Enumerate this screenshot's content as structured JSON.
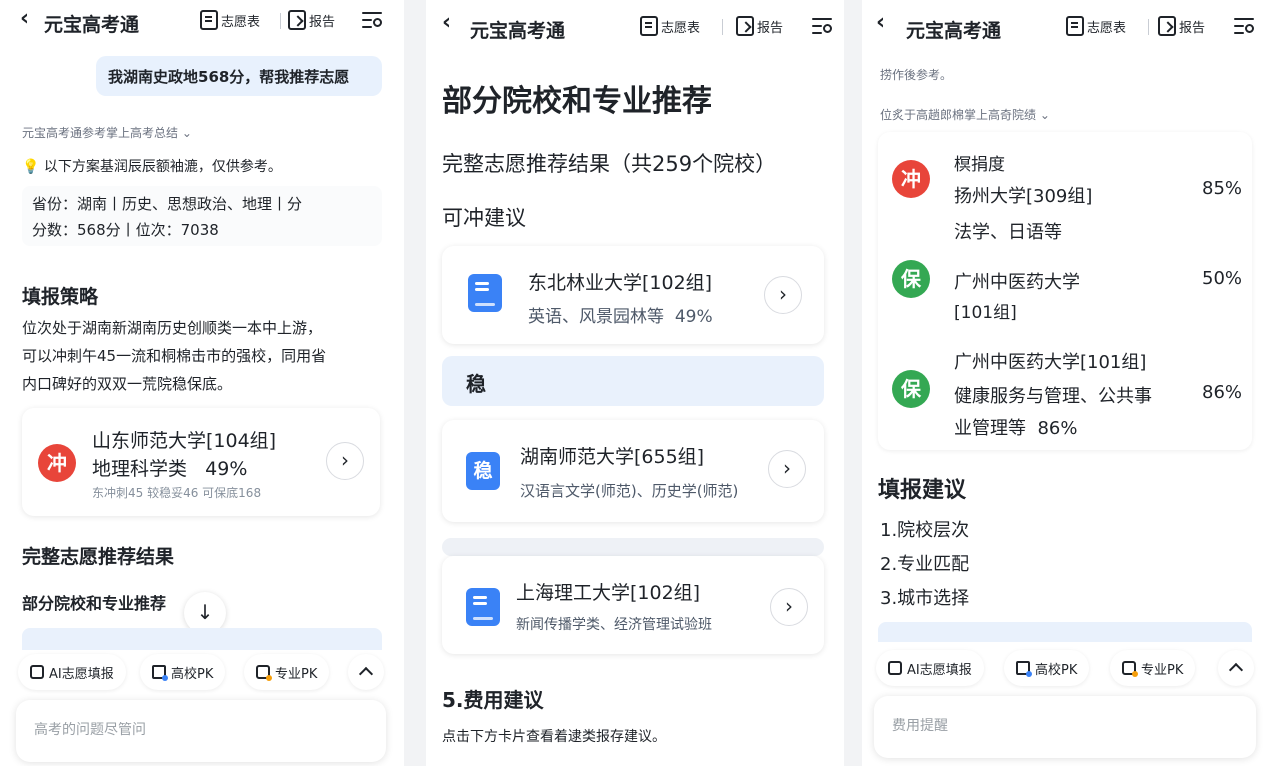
{
  "header": {
    "title": "元宝高考通",
    "volunteer_table": "志愿表",
    "report": "报告"
  },
  "panel1": {
    "user_message": "我湖南史政地568分，帮我推荐志愿",
    "summary_toggle": "元宝高考通参考掌上高考总结",
    "notice": "以下方案基润辰辰额袖漉，仅供参考。",
    "profile_line1": "省份：湖南丨历史、思想政治、地理丨分",
    "profile_line2": "分数：568分丨位次：7038",
    "strategy_title": "填报策略",
    "strategy_line1": "位次处于湖南新湖南历史创顺类一本中上游，",
    "strategy_line2": "可以冲刺午45一流和桐棉击市的强校，同用省",
    "strategy_line3": "内口碑好的双双一荒院稳保底。",
    "card": {
      "badge": "冲",
      "school": "山东师范大学[104组]",
      "major": "地理科学类",
      "rate": "49%",
      "stats": "东冲刺45 较稳妥46  可保底168"
    },
    "full_result_title": "完整志愿推荐结果",
    "partial_title": "部分院校和专业推荐",
    "input_placeholder": "高考的问题尽管问"
  },
  "toolbar": {
    "ai_fill": "AI志愿填报",
    "school_pk": "高校PK",
    "major_pk": "专业PK"
  },
  "panel2": {
    "heading": "部分院校和专业推荐",
    "full_result": "完整志愿推荐结果（共259个院校）",
    "chong_title": "可冲建议",
    "card1": {
      "school": "东北林业大学[102组]",
      "majors": "英语、风景园林等",
      "rate": "49%"
    },
    "wen_label": "稳",
    "card2": {
      "icon": "稳",
      "school": "湖南师范大学[655组]",
      "majors": "汉语言文学(师范)、历史学(师范)"
    },
    "card3": {
      "school": "上海理工大学[102组]",
      "majors": "新闻传播学类、经济管理试验班"
    },
    "fee_title": "5.费用建议",
    "fee_desc": "点击下方卡片查看着逮类报存建议。"
  },
  "panel3": {
    "top_text": "捞作後参考。",
    "summary_toggle": "位炙于高趟郎棉掌上高奇院绩",
    "list": [
      {
        "badge": "冲",
        "pre": "榠捐度",
        "school": "扬州大学[309组]",
        "majors": "法学、日语等",
        "rate": "85%"
      },
      {
        "badge": "保",
        "school_line1": "广州中医药大学",
        "school_line2": "[101组]",
        "rate": "50%"
      },
      {
        "badge": "保",
        "school": "广州中医药大学[101组]",
        "majors_line1": "健康服务与管理、公共事",
        "majors_line2": "业管理等",
        "inline_rate": "86%",
        "rate": "86%"
      }
    ],
    "advice_title": "填报建议",
    "advice_items": [
      "1.院校层次",
      "2.专业匹配",
      "3.城市选择"
    ],
    "input_placeholder": "费用提醒"
  },
  "colors": {
    "accent_blue": "#3a82f6",
    "badge_red": "#e8453a",
    "badge_green": "#34a853",
    "bubble_bg": "#e8f1fd"
  }
}
